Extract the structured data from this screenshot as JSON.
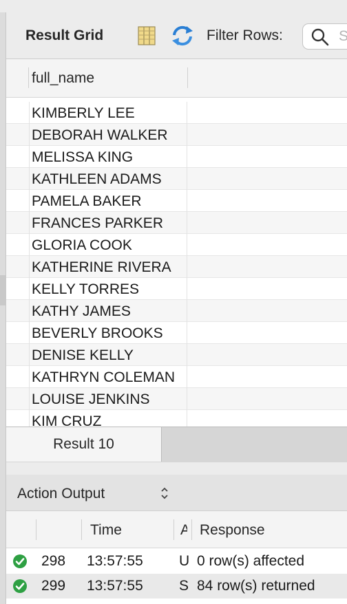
{
  "toolbar": {
    "result_grid_label": "Result Grid",
    "filter_rows_label": "Filter Rows:",
    "search_placeholder": "S"
  },
  "grid": {
    "column_header": "full_name",
    "rows": [
      "KIMBERLY LEE",
      "DEBORAH WALKER",
      "MELISSA KING",
      "KATHLEEN ADAMS",
      "PAMELA BAKER",
      "FRANCES PARKER",
      "GLORIA COOK",
      "KATHERINE RIVERA",
      "KELLY TORRES",
      "KATHY JAMES",
      "BEVERLY BROOKS",
      "DENISE KELLY",
      "KATHRYN COLEMAN",
      "LOUISE JENKINS",
      "KIM CRUZ"
    ]
  },
  "result_tabs": {
    "active_tab": "Result 10"
  },
  "action_output": {
    "title": "Action Output",
    "columns": {
      "time": "Time",
      "action": "A",
      "response": "Response"
    },
    "rows": [
      {
        "status": "success",
        "number": "298",
        "time": "13:57:55",
        "action": "U",
        "response": "0 row(s) affected"
      },
      {
        "status": "success",
        "number": "299",
        "time": "13:57:55",
        "action": "S",
        "response": "84 row(s) returned"
      }
    ]
  },
  "colors": {
    "success": "#2ea043",
    "accent_blue": "#2a7fd4"
  },
  "icons": [
    "columns-icon",
    "refresh-icon",
    "search-icon",
    "up-down-chevron-icon",
    "success-check-icon"
  ]
}
